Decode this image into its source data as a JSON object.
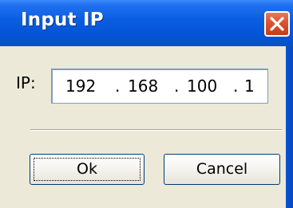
{
  "window": {
    "title": "Input IP"
  },
  "form": {
    "ip_label": "IP:",
    "octets": [
      "192",
      "168",
      "100",
      "1"
    ],
    "dot": "."
  },
  "buttons": {
    "ok_label": "Ok",
    "cancel_label": "Cancel"
  },
  "icons": {
    "close": "close-icon"
  },
  "colors": {
    "titlebar": "#0a5de0",
    "close_button": "#d9532f",
    "dialog_background": "#ece9d8",
    "field_border": "#7f9db9",
    "button_border": "#003c74"
  }
}
